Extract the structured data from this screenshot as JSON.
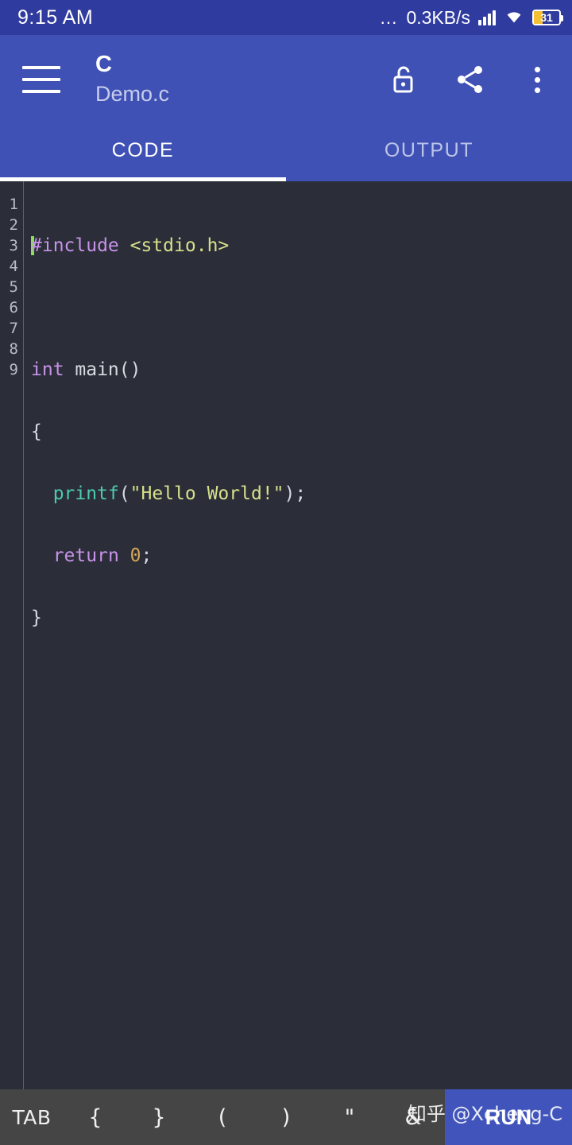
{
  "statusbar": {
    "time": "9:15 AM",
    "dots": "…",
    "network_speed": "0.3KB/s",
    "signal_icon": "signal-bars-icon",
    "wifi_icon": "wifi-icon",
    "battery_percent": "31",
    "battery_icon": "battery-icon"
  },
  "appbar": {
    "menu_icon": "hamburger-menu-icon",
    "title": "C",
    "subtitle": "Demo.c",
    "lock_icon": "unlock-icon",
    "share_icon": "share-icon",
    "overflow_icon": "overflow-menu-icon"
  },
  "tabs": {
    "items": [
      {
        "label": "CODE",
        "active": true
      },
      {
        "label": "OUTPUT",
        "active": false
      }
    ]
  },
  "editor": {
    "line_numbers": [
      "1",
      "2",
      "3",
      "4",
      "5",
      "6",
      "7",
      "8",
      "9"
    ],
    "cursor_line": 1,
    "cursor_column": 1,
    "lines": [
      {
        "n": 1,
        "text": "#include <stdio.h>"
      },
      {
        "n": 2,
        "text": ""
      },
      {
        "n": 3,
        "text": "int main()"
      },
      {
        "n": 4,
        "text": "{"
      },
      {
        "n": 5,
        "text": "  printf(\"Hello World!\");"
      },
      {
        "n": 6,
        "text": "  return 0;"
      },
      {
        "n": 7,
        "text": "}"
      },
      {
        "n": 8,
        "text": ""
      },
      {
        "n": 9,
        "text": ""
      }
    ],
    "code_tokens": {
      "l1_pre": "#include",
      "l1_space": " ",
      "l1_hdr": "<stdio.h>",
      "l3_kw": "int",
      "l3_rest": " main()",
      "l4": "{",
      "l5_indent": "  ",
      "l5_fn": "printf",
      "l5_open": "(",
      "l5_str": "\"Hello World!\"",
      "l5_close": ");",
      "l6_indent": "  ",
      "l6_kw": "return",
      "l6_space": " ",
      "l6_num": "0",
      "l6_semi": ";",
      "l7": "}"
    }
  },
  "symbar": {
    "keys": [
      "TAB",
      "{",
      "}",
      "(",
      ")",
      "\"",
      "&"
    ],
    "run_label": "RUN"
  },
  "watermark": {
    "text": "知乎 @Xcheng-C"
  },
  "colors": {
    "statusbar_bg": "#2f3b9e",
    "appbar_bg": "#3f51b5",
    "editor_bg": "#2b2e38",
    "symbar_bg": "#454545",
    "run_bg": "#4054bb",
    "battery_fill": "#f5c033",
    "caret": "#8ddd5b",
    "keyword": "#c792ea",
    "function": "#4ec9b0",
    "string": "#d6e08a",
    "number": "#d8a657",
    "plain_text": "#d7dae0",
    "line_number": "#b9bcc6"
  }
}
